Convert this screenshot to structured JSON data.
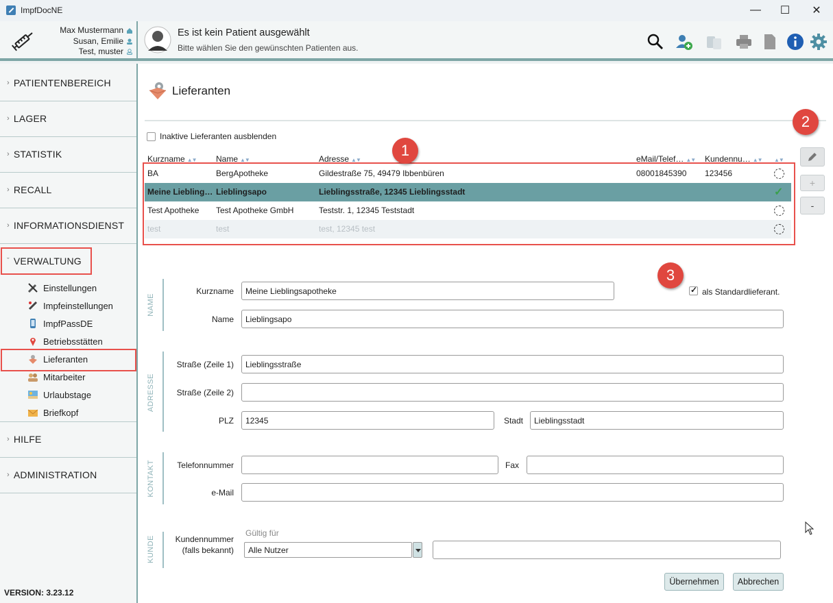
{
  "window": {
    "title": "ImpfDocNE"
  },
  "header": {
    "users": [
      "Max Mustermann",
      "Susan, Emilie",
      "Test, muster"
    ],
    "patient_title": "Es ist kein Patient ausgewählt",
    "patient_subtitle": "Bitte wählen Sie den gewünschten Patienten aus."
  },
  "sidebar": {
    "sections": [
      "PATIENTENBEREICH",
      "LAGER",
      "STATISTIK",
      "RECALL",
      "INFORMATIONSDIENST",
      "VERWALTUNG",
      "HILFE",
      "ADMINISTRATION"
    ],
    "sub_items": [
      "Einstellungen",
      "Impfeinstellungen",
      "ImpfPassDE",
      "Betriebsstätten",
      "Lieferanten",
      "Mitarbeiter",
      "Urlaubstage",
      "Briefkopf"
    ],
    "version": "VERSION: 3.23.12"
  },
  "main": {
    "title": "Lieferanten",
    "hide_inactive_label": "Inaktive Lieferanten ausblenden",
    "columns": [
      "Kurzname",
      "Name",
      "Adresse",
      "eMail/Telef…",
      "Kundennu…"
    ],
    "rows": [
      {
        "kurzname": "BA",
        "name": "BergApotheke",
        "adresse": "Gildestraße 75, 49479 Ibbenbüren",
        "email": "08001845390",
        "kundennr": "123456"
      },
      {
        "kurzname": "Meine Liebling…",
        "name": "Lieblingsapo",
        "adresse": "Lieblingsstraße, 12345 Lieblingsstadt",
        "email": "",
        "kundennr": ""
      },
      {
        "kurzname": "Test Apotheke",
        "name": "Test Apotheke GmbH",
        "adresse": "Teststr. 1, 12345 Teststadt",
        "email": "",
        "kundennr": ""
      },
      {
        "kurzname": "test",
        "name": "test",
        "adresse": "test, 12345 test",
        "email": "",
        "kundennr": ""
      }
    ],
    "side_buttons": {
      "add": "+",
      "remove": "-"
    },
    "badges": [
      "1",
      "2",
      "3"
    ]
  },
  "form": {
    "sections": {
      "name": "NAME",
      "adresse": "ADRESSE",
      "kontakt": "KONTAKT",
      "kunde": "KUNDE"
    },
    "labels": {
      "kurzname": "Kurzname",
      "name": "Name",
      "strasse1": "Straße (Zeile 1)",
      "strasse2": "Straße (Zeile 2)",
      "plz": "PLZ",
      "stadt": "Stadt",
      "telefon": "Telefonnummer",
      "fax": "Fax",
      "email": "e-Mail",
      "kundennummer": "Kundennummer",
      "kundennummer_hint": "(falls bekannt)",
      "gueltig": "Gültig für",
      "standard": "als Standardlieferant."
    },
    "values": {
      "kurzname": "Meine Lieblingsapotheke",
      "name": "Lieblingsapo",
      "strasse1": "Lieblingsstraße",
      "strasse2": "",
      "plz": "12345",
      "stadt": "Lieblingsstadt",
      "telefon": "",
      "fax": "",
      "email": "",
      "kundennummer": "",
      "gueltig_selected": "Alle Nutzer"
    },
    "buttons": {
      "apply": "Übernehmen",
      "cancel": "Abbrechen"
    }
  }
}
